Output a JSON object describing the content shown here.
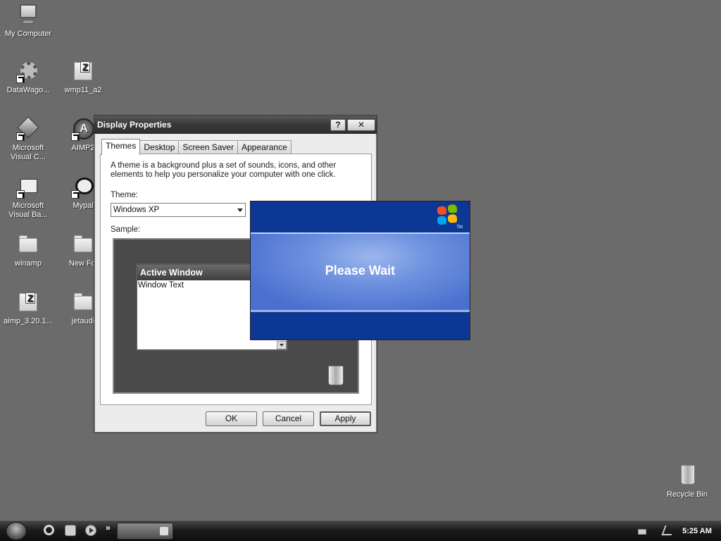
{
  "desktop": {
    "icons": [
      {
        "label": "My Computer"
      },
      {
        "label": "DataWago..."
      },
      {
        "label": "wmp11_a2"
      },
      {
        "label": "Microsoft\nVisual C..."
      },
      {
        "label": "AIMP2"
      },
      {
        "label": "Microsoft\nVisual Ba..."
      },
      {
        "label": "Mypal"
      },
      {
        "label": "winamp"
      },
      {
        "label": "New Fol"
      },
      {
        "label": "aimp_3.20.1..."
      },
      {
        "label": "jetaudi"
      },
      {
        "label": "Recycle Bin"
      }
    ]
  },
  "display_properties": {
    "title": "Display Properties",
    "help_button": "?",
    "close_button": "✕",
    "tabs": [
      {
        "label": "Themes",
        "active": true
      },
      {
        "label": "Desktop",
        "active": false
      },
      {
        "label": "Screen Saver",
        "active": false
      },
      {
        "label": "Appearance",
        "active": false
      }
    ],
    "description": "A theme is a background plus a set of sounds, icons, and other elements to help you personalize your computer with one click.",
    "theme_label": "Theme:",
    "theme_value": "Windows XP",
    "sample_label": "Sample:",
    "sample": {
      "active_window_title": "Active Window",
      "window_text": "Window Text"
    },
    "buttons": {
      "ok": "OK",
      "cancel": "Cancel",
      "apply": "Apply"
    }
  },
  "splash": {
    "message": "Please Wait",
    "logo_tm": "TM",
    "logo_colors": [
      "#f25022",
      "#7fba00",
      "#00a4ef",
      "#ffb900"
    ]
  },
  "taskbar": {
    "quick_launch_more": "»",
    "clock": "5:25 AM"
  },
  "icons": {
    "start": "start-orb-icon",
    "internet_explorer": "internet-explorer-icon",
    "show_desktop": "show-desktop-icon",
    "media_player": "media-player-icon",
    "keyboard": "keyboard-icon",
    "network": "network-icon"
  }
}
